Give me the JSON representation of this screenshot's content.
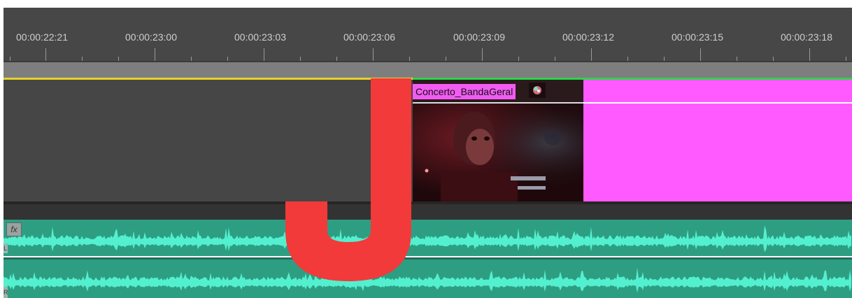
{
  "ruler": {
    "timecodes": [
      "00:00:22:21",
      "00:00:23:00",
      "00:00:23:03",
      "00:00:23:06",
      "00:00:23:09",
      "00:00:23:12",
      "00:00:23:15",
      "00:00:23:18"
    ]
  },
  "video_clip": {
    "name": "Concerto_BandaGeral"
  },
  "audio": {
    "fx_badge": "fx",
    "left_channel": "L",
    "right_channel": "R"
  },
  "overlay": {
    "letter": "J"
  },
  "colors": {
    "ruler_bg": "#474747",
    "track_bg": "#464646",
    "clip_label": "#f25bf2",
    "offline_media": "#ff5aff",
    "audio_clip": "#2e9e83",
    "waveform": "#53f0cf",
    "in_point_line": "#e6d22c",
    "clip_line": "#2fd34b",
    "overlay_letter": "#f23a3a"
  }
}
